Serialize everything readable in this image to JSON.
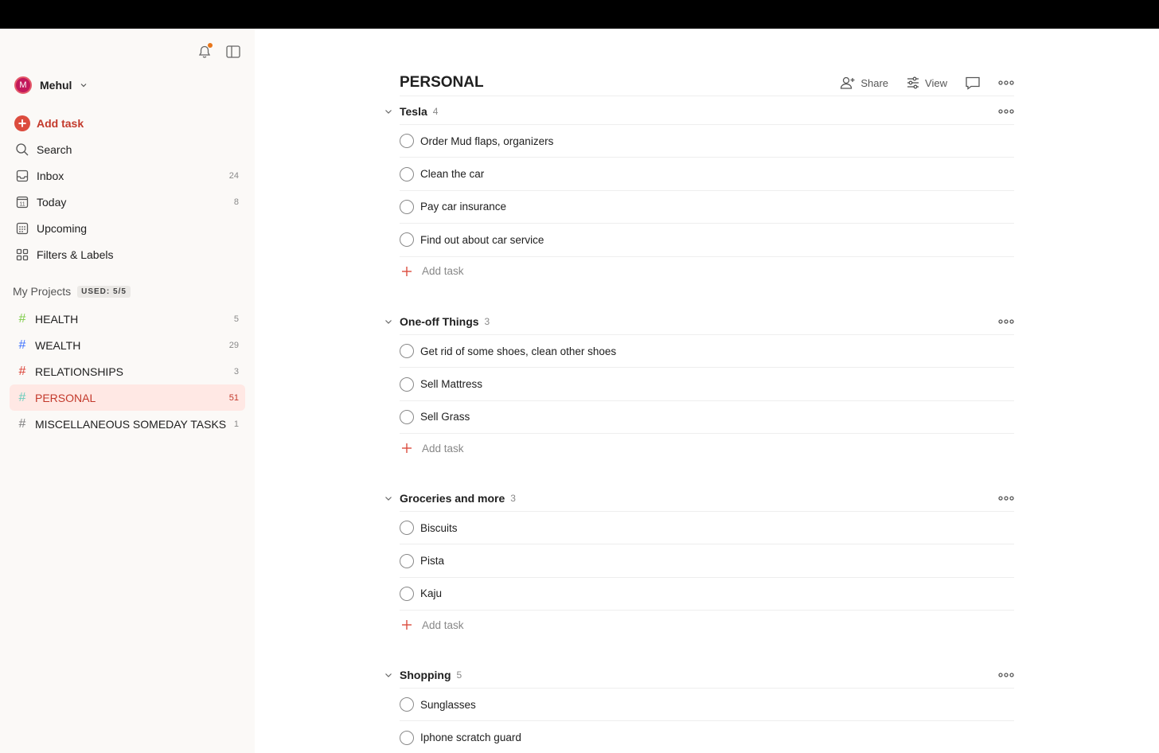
{
  "sidebar": {
    "user": {
      "initial": "M",
      "name": "Mehul"
    },
    "nav": [
      {
        "label": "Add task",
        "icon": "plus-circle-icon"
      },
      {
        "label": "Search",
        "icon": "search-icon"
      },
      {
        "label": "Inbox",
        "icon": "inbox-icon",
        "count": "24"
      },
      {
        "label": "Today",
        "icon": "calendar-today-icon",
        "count": "8",
        "day": "11"
      },
      {
        "label": "Upcoming",
        "icon": "calendar-grid-icon"
      },
      {
        "label": "Filters & Labels",
        "icon": "grid-icon"
      }
    ],
    "projects_title": "My Projects",
    "used_badge": "USED: 5/5",
    "projects": [
      {
        "label": "HEALTH",
        "count": "5",
        "color": "#7ecc49"
      },
      {
        "label": "WEALTH",
        "count": "29",
        "color": "#4073ff"
      },
      {
        "label": "RELATIONSHIPS",
        "count": "3",
        "color": "#db4035"
      },
      {
        "label": "PERSONAL",
        "count": "51",
        "color": "#6accbc"
      },
      {
        "label": "MISCELLANEOUS SOMEDAY TASKS",
        "count": "1",
        "color": "#808080"
      }
    ]
  },
  "main": {
    "title": "PERSONAL",
    "actions": {
      "share": "Share",
      "view": "View"
    },
    "add_task_label": "Add task",
    "sections": [
      {
        "title": "Tesla",
        "count": "4",
        "tasks": [
          "Order Mud flaps, organizers",
          "Clean the car",
          "Pay car insurance",
          "Find out about car service"
        ]
      },
      {
        "title": "One-off Things",
        "count": "3",
        "tasks": [
          "Get rid of some shoes, clean other shoes",
          "Sell Mattress",
          "Sell Grass"
        ]
      },
      {
        "title": "Groceries and more",
        "count": "3",
        "tasks": [
          "Biscuits",
          "Pista",
          "Kaju"
        ]
      },
      {
        "title": "Shopping",
        "count": "5",
        "tasks": [
          "Sunglasses",
          "Iphone scratch guard"
        ]
      }
    ]
  },
  "colors": {
    "accent": "#dc4c3e",
    "active_bg": "#ffe8e4",
    "sidebar_bg": "#fbf9f7"
  }
}
